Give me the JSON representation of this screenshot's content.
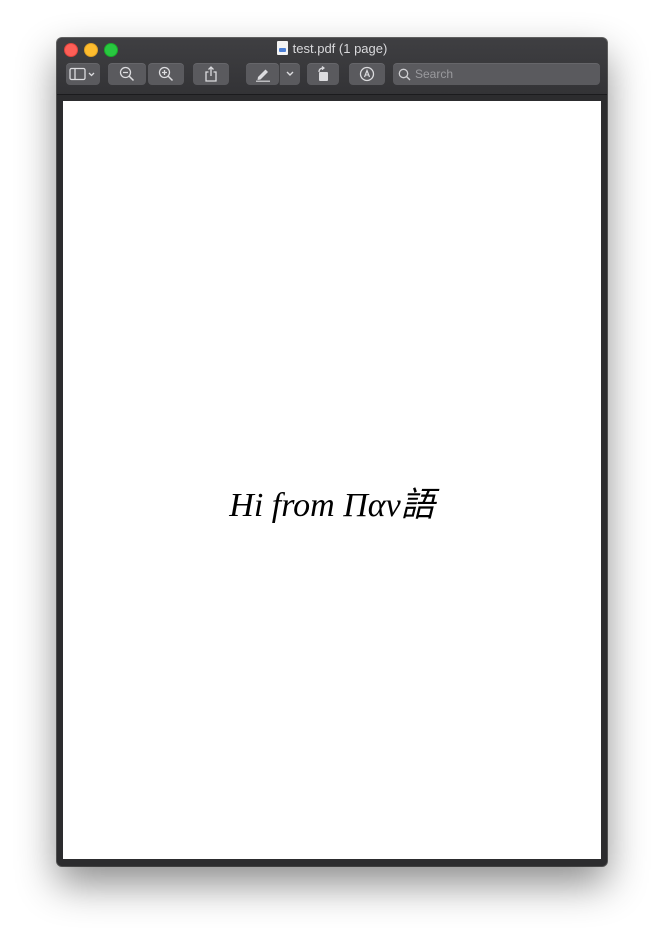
{
  "window": {
    "title": "test.pdf (1 page)",
    "title_icon": "pdf-document-icon"
  },
  "toolbar": {
    "sidebar_toggle_icon": "sidebar-icon",
    "zoom_out_icon": "zoom-out-icon",
    "zoom_in_icon": "zoom-in-icon",
    "share_icon": "share-icon",
    "highlight_icon": "highlighter-icon",
    "rotate_icon": "rotate-left-icon",
    "markup_icon": "markup-pen-icon",
    "search": {
      "placeholder": "Search",
      "value": ""
    }
  },
  "document": {
    "page_text": "Hi from Παν語"
  },
  "colors": {
    "close": "#fd5f57",
    "minimize": "#febc2e",
    "maximize": "#28c840",
    "chrome": "#3a3a3c",
    "page": "#ffffff"
  }
}
